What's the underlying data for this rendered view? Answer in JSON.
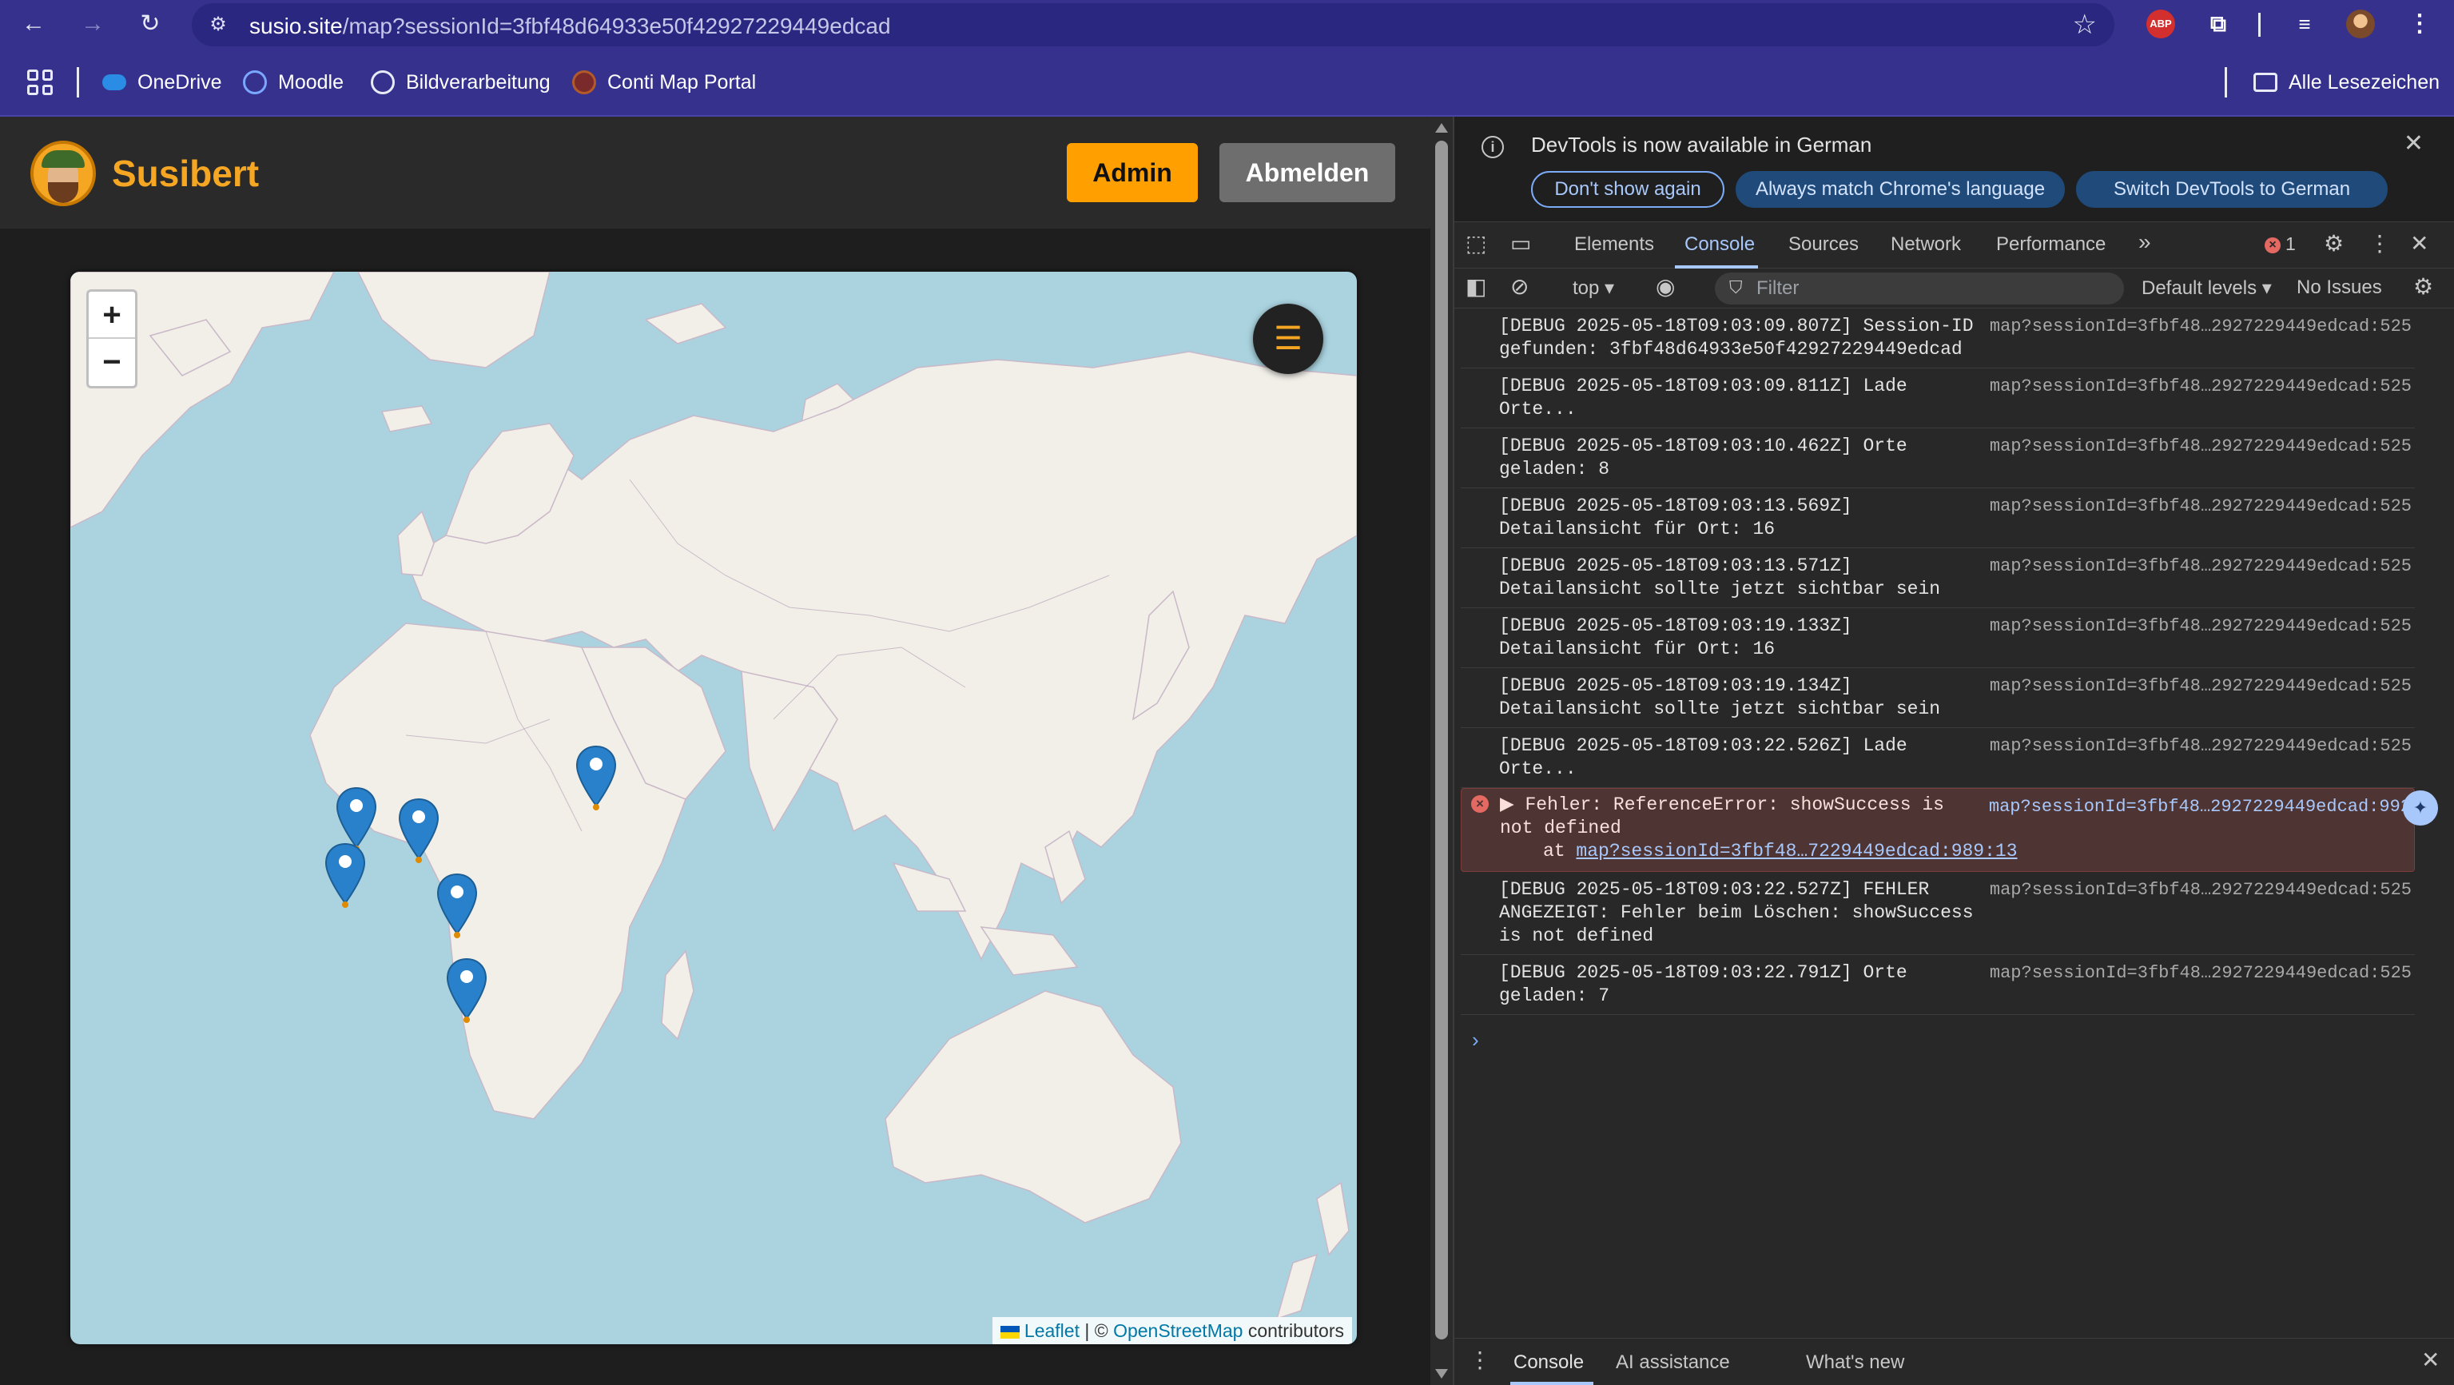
{
  "browser": {
    "url_host": "susio.site",
    "url_path": "/map?sessionId=3fbf48d64933e50f42927229449edcad",
    "bookmarks": [
      {
        "label": "OneDrive",
        "icon": "onedrive-icon"
      },
      {
        "label": "Moodle",
        "icon": "moodle-icon"
      },
      {
        "label": "Bildverarbeitung",
        "icon": "globe-icon"
      },
      {
        "label": "Conti Map Portal",
        "icon": "conti-icon"
      }
    ],
    "all_bookmarks_label": "Alle Lesezeichen",
    "extension_abp_label": "ABP"
  },
  "site": {
    "title": "Susibert",
    "admin_label": "Admin",
    "logout_label": "Abmelden",
    "accent_color": "#f5a623"
  },
  "map": {
    "zoom_in_label": "+",
    "zoom_out_label": "−",
    "menu_icon": "☰",
    "attribution_leaflet": "Leaflet",
    "attribution_sep": " | © ",
    "attribution_osm": "OpenStreetMap",
    "attribution_tail": " contributors",
    "marker_color": "#2a81cb"
  },
  "devtools": {
    "info_message": "DevTools is now available in German",
    "btn_dont_show": "Don't show again",
    "btn_match_language": "Always match Chrome's language",
    "btn_switch_german": "Switch DevTools to German",
    "tabs": [
      "Elements",
      "Console",
      "Sources",
      "Network",
      "Performance"
    ],
    "active_tab": "Console",
    "error_count": "1",
    "context": "top ▾",
    "filter_placeholder": "Filter",
    "levels": "Default levels ▾",
    "issues": "No Issues",
    "logs": [
      {
        "text": "[DEBUG 2025-05-18T09:03:09.807Z] Session-ID gefunden: 3fbf48d64933e50f42927229449edcad",
        "src": "map?sessionId=3fbf48…2927229449edcad:525"
      },
      {
        "text": "[DEBUG 2025-05-18T09:03:09.811Z] Lade Orte...",
        "src": "map?sessionId=3fbf48…2927229449edcad:525"
      },
      {
        "text": "[DEBUG 2025-05-18T09:03:10.462Z] Orte geladen: 8",
        "src": "map?sessionId=3fbf48…2927229449edcad:525"
      },
      {
        "text": "[DEBUG 2025-05-18T09:03:13.569Z] Detailansicht für Ort: 16",
        "src": "map?sessionId=3fbf48…2927229449edcad:525"
      },
      {
        "text": "[DEBUG 2025-05-18T09:03:13.571Z] Detailansicht sollte jetzt sichtbar sein",
        "src": "map?sessionId=3fbf48…2927229449edcad:525"
      },
      {
        "text": "[DEBUG 2025-05-18T09:03:19.133Z] Detailansicht für Ort: 16",
        "src": "map?sessionId=3fbf48…2927229449edcad:525"
      },
      {
        "text": "[DEBUG 2025-05-18T09:03:19.134Z] Detailansicht sollte jetzt sichtbar sein",
        "src": "map?sessionId=3fbf48…2927229449edcad:525"
      },
      {
        "text": "[DEBUG 2025-05-18T09:03:22.526Z] Lade Orte...",
        "src": "map?sessionId=3fbf48…2927229449edcad:525"
      }
    ],
    "error_entry": {
      "text": "▶ Fehler: ReferenceError: showSuccess is not defined",
      "trace_prefix": "at ",
      "trace_link": "map?sessionId=3fbf48…7229449edcad:989:13",
      "src": "map?sessionId=3fbf48…2927229449edcad:992"
    },
    "logs_after": [
      {
        "text": "[DEBUG 2025-05-18T09:03:22.527Z] FEHLER ANGEZEIGT: Fehler beim Löschen: showSuccess is not defined",
        "src": "map?sessionId=3fbf48…2927229449edcad:525"
      },
      {
        "text": "[DEBUG 2025-05-18T09:03:22.791Z] Orte geladen: 7",
        "src": "map?sessionId=3fbf48…2927229449edcad:525"
      }
    ],
    "prompt": "›",
    "drawer_tabs": [
      "Console",
      "AI assistance",
      "What's new"
    ]
  }
}
